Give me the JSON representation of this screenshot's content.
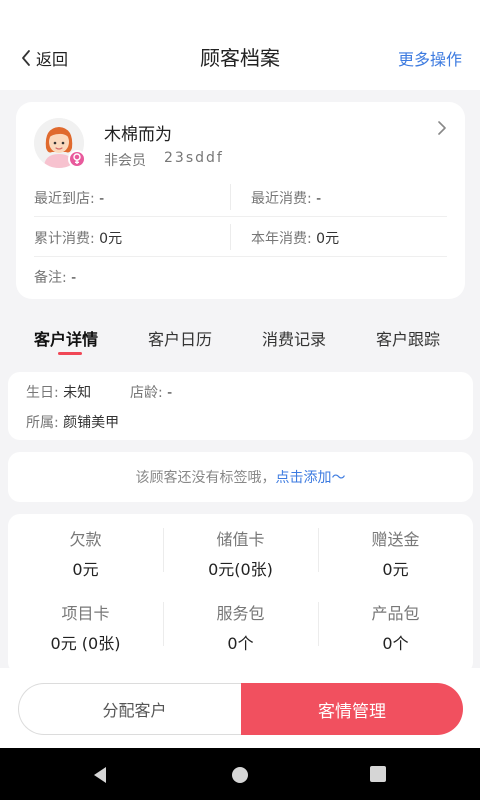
{
  "header": {
    "back_label": "返回",
    "title": "顾客档案",
    "more_label": "更多操作"
  },
  "profile": {
    "name": "木棉而为",
    "member_status": "非会员",
    "code": "23sddf",
    "last_visit_label": "最近到店:",
    "last_visit_value": "-",
    "last_spend_label": "最近消费:",
    "last_spend_value": "-",
    "total_spend_label": "累计消费:",
    "total_spend_value": "0元",
    "year_spend_label": "本年消费:",
    "year_spend_value": "0元",
    "note_label": "备注:",
    "note_value": "-"
  },
  "tabs": [
    {
      "label": "客户详情",
      "active": true
    },
    {
      "label": "客户日历",
      "active": false
    },
    {
      "label": "消费记录",
      "active": false
    },
    {
      "label": "客户跟踪",
      "active": false
    }
  ],
  "details": {
    "birthday_label": "生日:",
    "birthday_value": "未知",
    "store_age_label": "店龄:",
    "store_age_value": "-",
    "belongs_label": "所属:",
    "belongs_value": "颜铺美甲"
  },
  "tags": {
    "empty_text": "该顾客还没有标签哦，",
    "add_link": "点击添加〜"
  },
  "assets": [
    {
      "label": "欠款",
      "value": "0元"
    },
    {
      "label": "储值卡",
      "value": "0元(0张)"
    },
    {
      "label": "赠送金",
      "value": "0元"
    },
    {
      "label": "项目卡",
      "value": "0元 (0张)"
    },
    {
      "label": "服务包",
      "value": "0个"
    },
    {
      "label": "产品包",
      "value": "0个"
    }
  ],
  "actions": {
    "assign_label": "分配客户",
    "manage_label": "客情管理"
  },
  "colors": {
    "accent_red": "#f1505f",
    "link_blue": "#3d7be0",
    "gender_female": "#e85a9c"
  }
}
